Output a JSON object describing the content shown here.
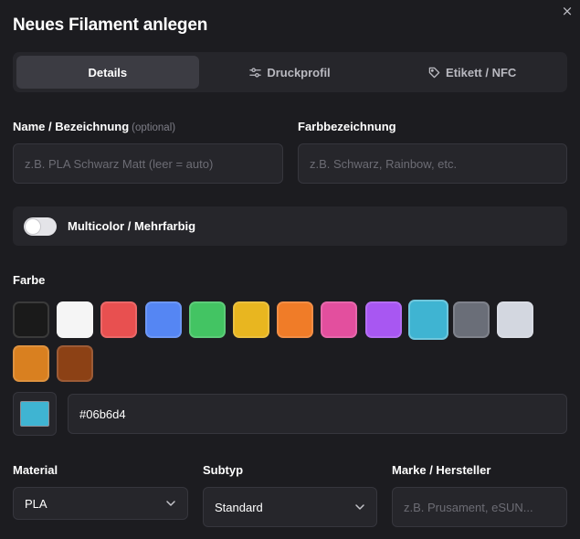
{
  "dialog": {
    "title": "Neues Filament anlegen",
    "close_glyph": "×"
  },
  "tabs": [
    {
      "label": "Details",
      "icon": "",
      "active": true
    },
    {
      "label": "Druckprofil",
      "icon": "sliders-icon",
      "active": false
    },
    {
      "label": "Etikett / NFC",
      "icon": "tag-icon",
      "active": false
    }
  ],
  "name": {
    "label": "Name / Bezeichnung",
    "optional": "(optional)",
    "value": "",
    "placeholder": "z.B. PLA Schwarz Matt (leer = auto)"
  },
  "color_name": {
    "label": "Farbbezeichnung",
    "value": "",
    "placeholder": "z.B. Schwarz, Rainbow, etc."
  },
  "multicolor": {
    "label": "Multicolor / Mehrfarbig",
    "enabled": false
  },
  "color": {
    "label": "Farbe",
    "swatches": [
      "#1a1a1a",
      "#f5f5f5",
      "#e85050",
      "#5586f3",
      "#43c463",
      "#e8b620",
      "#f07c28",
      "#e34f9e",
      "#a857f2",
      "#3fb4d2",
      "#6a6e78",
      "#d3d7e0",
      "#d98020",
      "#8c4115"
    ],
    "selected_index": 9,
    "hex_value": "#06b6d4",
    "preview_color": "#3fb4d2"
  },
  "material": {
    "label": "Material",
    "value": "PLA"
  },
  "subtype": {
    "label": "Subtyp",
    "value": "Standard"
  },
  "brand": {
    "label": "Marke / Hersteller",
    "value": "",
    "placeholder": "z.B. Prusament, eSUN..."
  }
}
